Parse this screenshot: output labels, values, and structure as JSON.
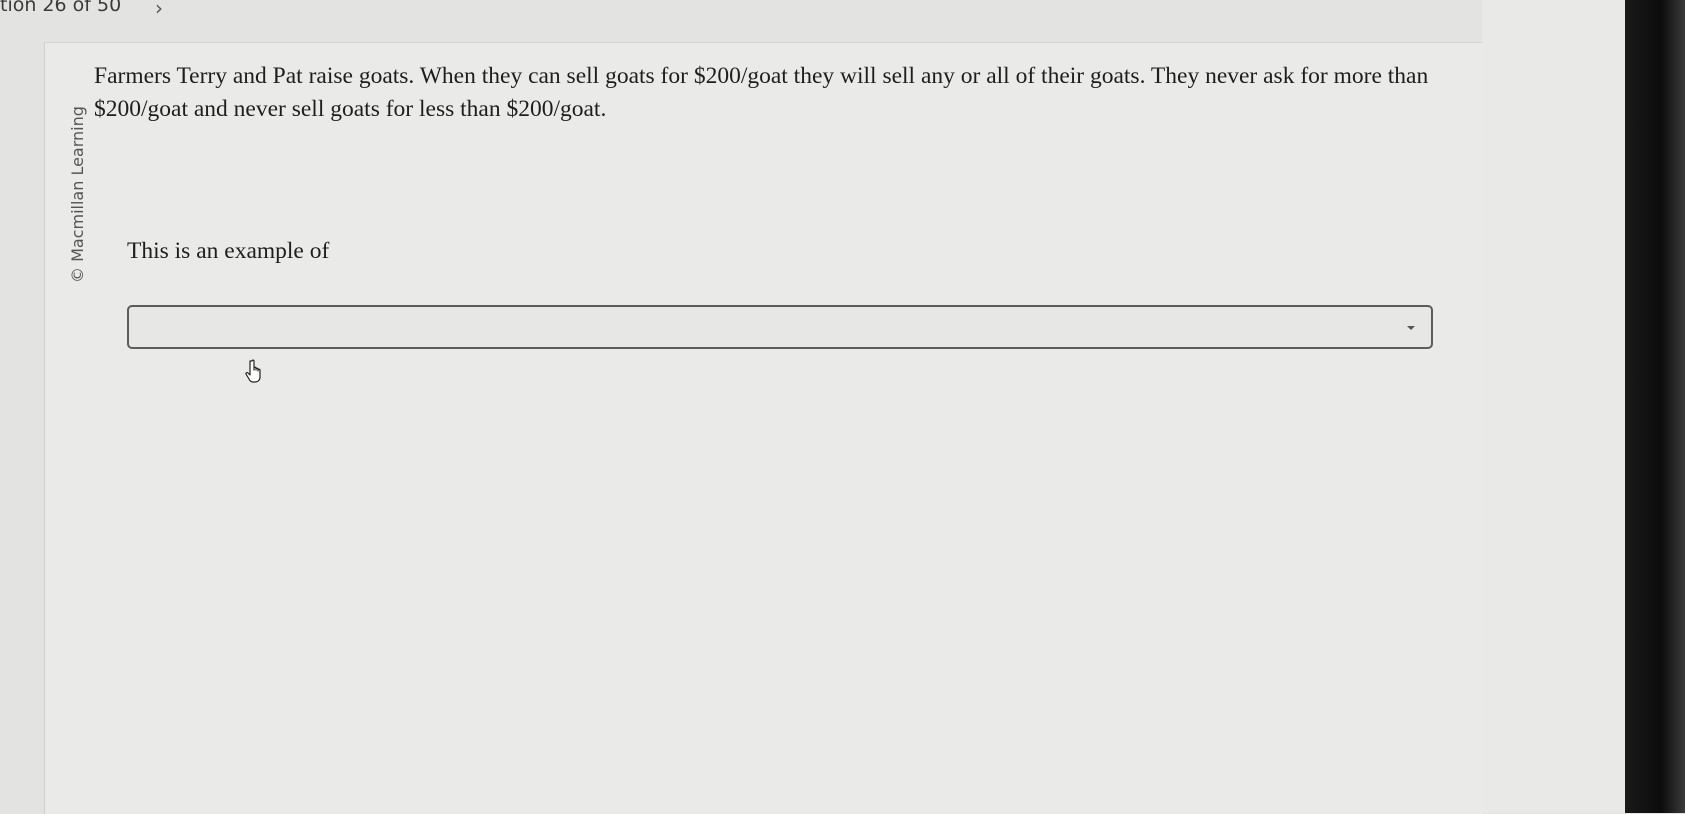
{
  "nav": {
    "question_counter": "tion 26 of 50",
    "next_icon": "chevron-right-icon",
    "next_glyph": "›"
  },
  "copyright": "© Macmillan Learning",
  "question": {
    "text": "Farmers Terry and Pat raise goats. When they can sell goats for $200/goat they will sell any or all of their goats. They never ask for more than $200/goat and never sell goats for less than $200/goat.",
    "prompt": "This is an example of"
  },
  "answer_dropdown": {
    "selected": "",
    "icon": "caret-down-icon"
  },
  "cursor": {
    "icon": "hand-pointer-icon"
  },
  "colors": {
    "page_background": "#eaeae8",
    "text": "#1e1e1e",
    "dropdown_border": "#5c5c5c"
  }
}
